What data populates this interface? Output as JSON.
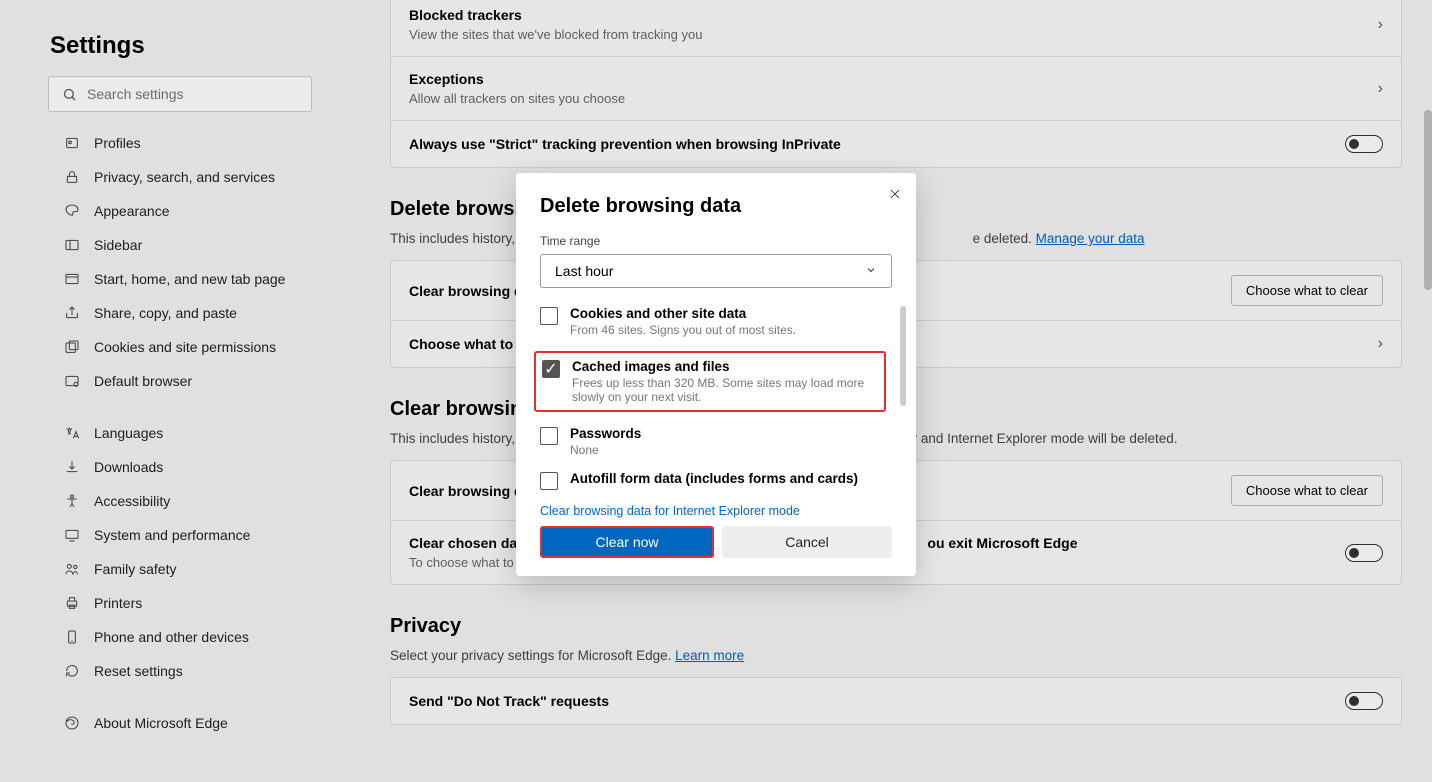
{
  "sidebar": {
    "title": "Settings",
    "search_placeholder": "Search settings",
    "items": [
      {
        "label": "Profiles"
      },
      {
        "label": "Privacy, search, and services"
      },
      {
        "label": "Appearance"
      },
      {
        "label": "Sidebar"
      },
      {
        "label": "Start, home, and new tab page"
      },
      {
        "label": "Share, copy, and paste"
      },
      {
        "label": "Cookies and site permissions"
      },
      {
        "label": "Default browser"
      }
    ],
    "items2": [
      {
        "label": "Languages"
      },
      {
        "label": "Downloads"
      },
      {
        "label": "Accessibility"
      },
      {
        "label": "System and performance"
      },
      {
        "label": "Family safety"
      },
      {
        "label": "Printers"
      },
      {
        "label": "Phone and other devices"
      },
      {
        "label": "Reset settings"
      }
    ],
    "about": "About Microsoft Edge"
  },
  "content": {
    "tracking": {
      "blocked_title": "Blocked trackers",
      "blocked_sub": "View the sites that we've blocked from tracking you",
      "exceptions_title": "Exceptions",
      "exceptions_sub": "Allow all trackers on sites you choose",
      "strict_title": "Always use \"Strict\" tracking prevention when browsing InPrivate"
    },
    "delete": {
      "heading": "Delete browsi",
      "desc_prefix": "This includes history,",
      "desc_suffix": "e deleted. ",
      "manage_link": "Manage your data",
      "clear_row": "Clear browsing da",
      "choose_row": "Choose what to c",
      "choose_btn": "Choose what to clear"
    },
    "clear_ie": {
      "heading": "Clear browsin",
      "desc_prefix": "This includes history,",
      "desc_suffix": "r and Internet Explorer mode will be deleted.",
      "clear_row": "Clear browsing da",
      "choose_btn": "Choose what to clear",
      "chosen_title": "Clear chosen data",
      "chosen_sub": "To choose what to cl",
      "chosen_right": "ou exit Microsoft Edge"
    },
    "privacy": {
      "heading": "Privacy",
      "desc": "Select your privacy settings for Microsoft Edge. ",
      "learn_link": "Learn more",
      "dnt_title": "Send \"Do Not Track\" requests"
    }
  },
  "dialog": {
    "title": "Delete browsing data",
    "time_label": "Time range",
    "time_value": "Last hour",
    "options": [
      {
        "title": "Cookies and other site data",
        "sub": "From 46 sites. Signs you out of most sites.",
        "checked": false,
        "highlighted": false
      },
      {
        "title": "Cached images and files",
        "sub": "Frees up less than 320 MB. Some sites may load more slowly on your next visit.",
        "checked": true,
        "highlighted": true
      },
      {
        "title": "Passwords",
        "sub": "None",
        "checked": false,
        "highlighted": false
      },
      {
        "title": "Autofill form data (includes forms and cards)",
        "sub": "",
        "checked": false,
        "highlighted": false
      }
    ],
    "ie_link": "Clear browsing data for Internet Explorer mode",
    "clear_btn": "Clear now",
    "cancel_btn": "Cancel"
  }
}
